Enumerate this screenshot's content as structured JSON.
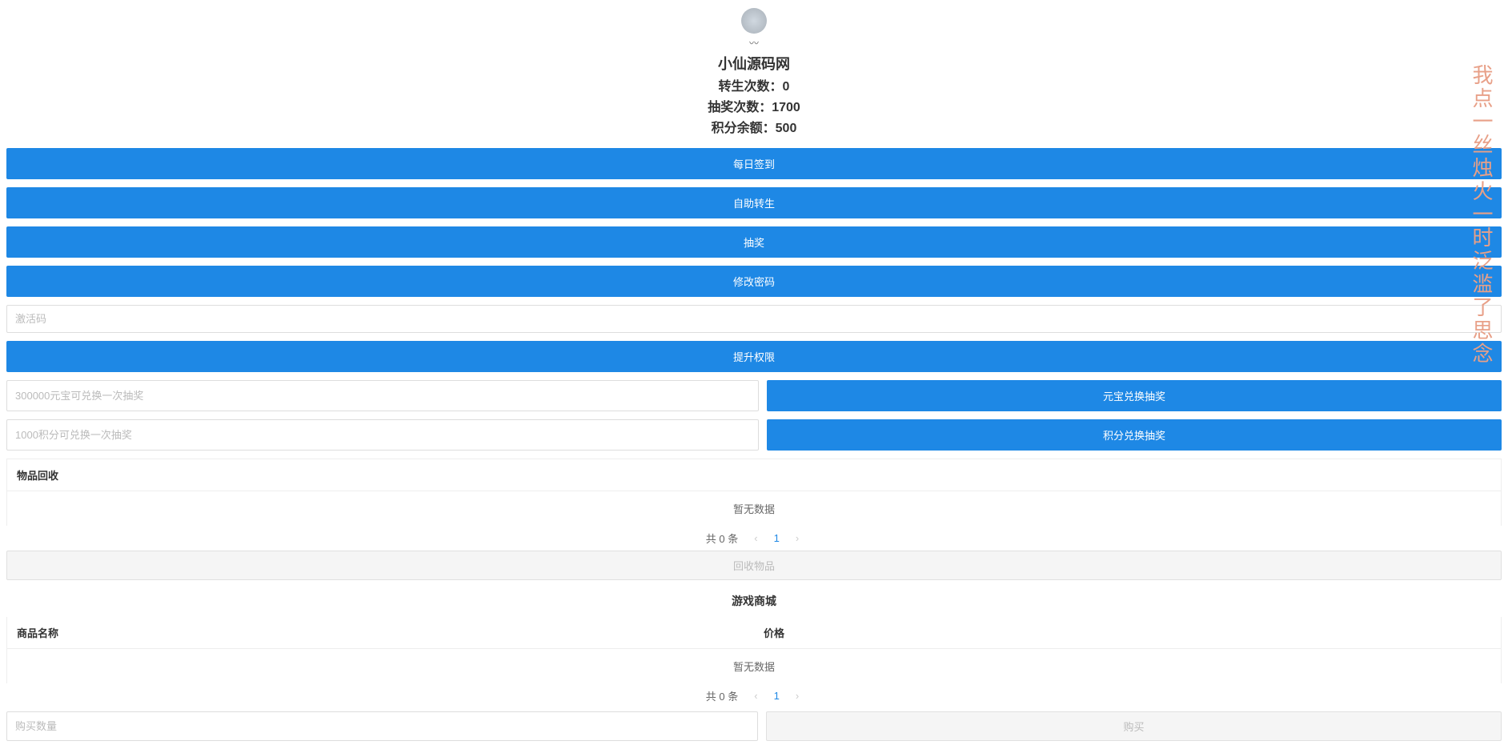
{
  "header": {
    "site_name": "小仙源码网",
    "rebirth_label": "转生次数：",
    "rebirth_value": "0",
    "lottery_label": "抽奖次数：",
    "lottery_value": "1700",
    "points_label": "积分余额：",
    "points_value": "500"
  },
  "buttons": {
    "daily_signin": "每日签到",
    "self_rebirth": "自助转生",
    "lottery": "抽奖",
    "change_password": "修改密码",
    "upgrade_permission": "提升权限",
    "yuanbao_exchange": "元宝兑换抽奖",
    "points_exchange": "积分兑换抽奖",
    "recycle_item": "回收物品",
    "buy": "购买"
  },
  "inputs": {
    "activation_placeholder": "激活码",
    "yuanbao_placeholder": "300000元宝可兑换一次抽奖",
    "points_placeholder": "1000积分可兑换一次抽奖",
    "buy_qty_placeholder": "购买数量"
  },
  "recycle": {
    "title": "物品回收",
    "empty": "暂无数据",
    "page_info": "共 0 条",
    "page_num": "1"
  },
  "shop": {
    "title": "游戏商城",
    "col_name": "商品名称",
    "col_price": "价格",
    "empty": "暂无数据",
    "page_info": "共 0 条",
    "page_num": "1"
  },
  "side_poem": "我点一丝烛火一时泛滥了思念"
}
